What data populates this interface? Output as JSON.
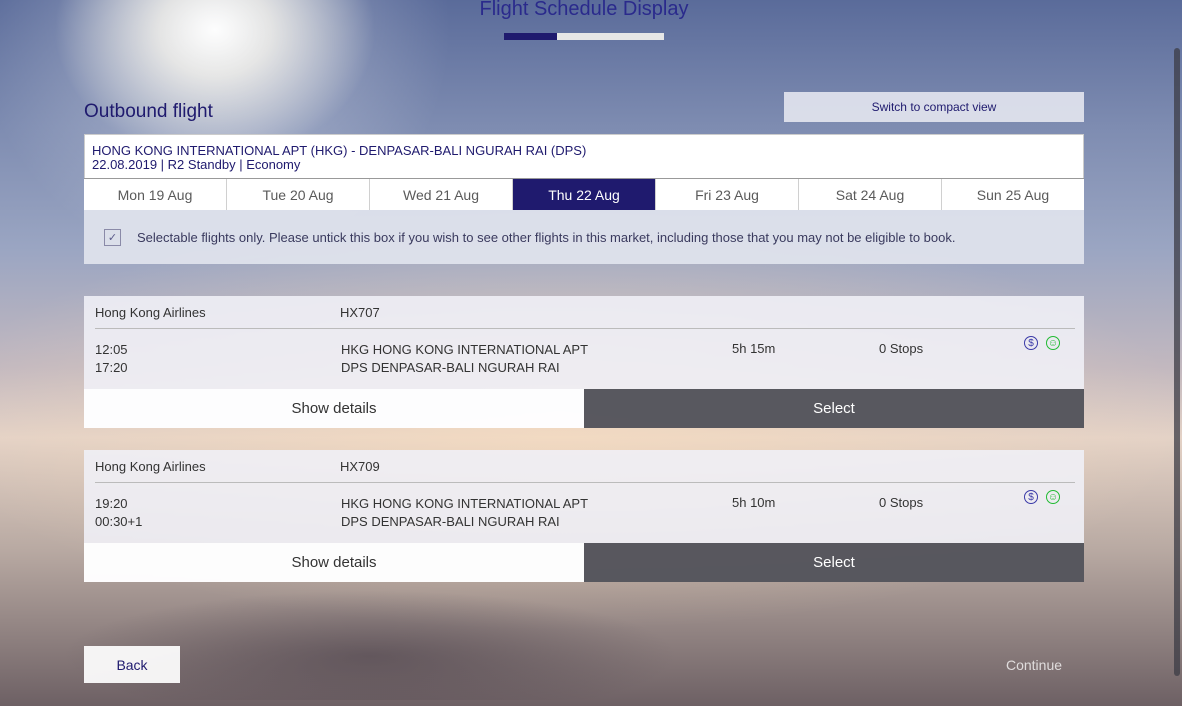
{
  "header": {
    "title": "Flight Schedule Display",
    "progress": 0.33
  },
  "outbound": {
    "title": "Outbound flight",
    "compact_view_label": "Switch to compact view",
    "route": "HONG KONG INTERNATIONAL APT (HKG) - DENPASAR-BALI NGURAH RAI (DPS)",
    "details": "22.08.2019 | R2 Standby | Economy"
  },
  "date_tabs": [
    {
      "label": "Mon 19 Aug",
      "active": false
    },
    {
      "label": "Tue 20 Aug",
      "active": false
    },
    {
      "label": "Wed 21 Aug",
      "active": false
    },
    {
      "label": "Thu 22 Aug",
      "active": true
    },
    {
      "label": "Fri 23 Aug",
      "active": false
    },
    {
      "label": "Sat 24 Aug",
      "active": false
    },
    {
      "label": "Sun 25 Aug",
      "active": false
    }
  ],
  "filter": {
    "checked": true,
    "label": "Selectable flights only. Please untick this box if you wish to see other flights in this market, including those that you may not be eligible to book."
  },
  "flights": [
    {
      "airline": "Hong Kong Airlines",
      "flight_number": "HX707",
      "depart_time": "12:05",
      "arrive_time": "17:20",
      "depart_airport": "HKG HONG KONG INTERNATIONAL APT",
      "arrive_airport": "DPS DENPASAR-BALI NGURAH RAI",
      "duration": "5h 15m",
      "stops": "0 Stops",
      "show_details_label": "Show details",
      "select_label": "Select"
    },
    {
      "airline": "Hong Kong Airlines",
      "flight_number": "HX709",
      "depart_time": "19:20",
      "arrive_time": "00:30+1",
      "depart_airport": "HKG HONG KONG INTERNATIONAL APT",
      "arrive_airport": "DPS DENPASAR-BALI NGURAH RAI",
      "duration": "5h 10m",
      "stops": "0 Stops",
      "show_details_label": "Show details",
      "select_label": "Select"
    }
  ],
  "footer": {
    "back_label": "Back",
    "continue_label": "Continue"
  },
  "icons": {
    "fare": "dollar-icon",
    "eligibility": "smile-icon",
    "checkbox": "checkmark-icon"
  },
  "colors": {
    "brand": "#1f1a6e",
    "eligible": "#22bb33"
  }
}
